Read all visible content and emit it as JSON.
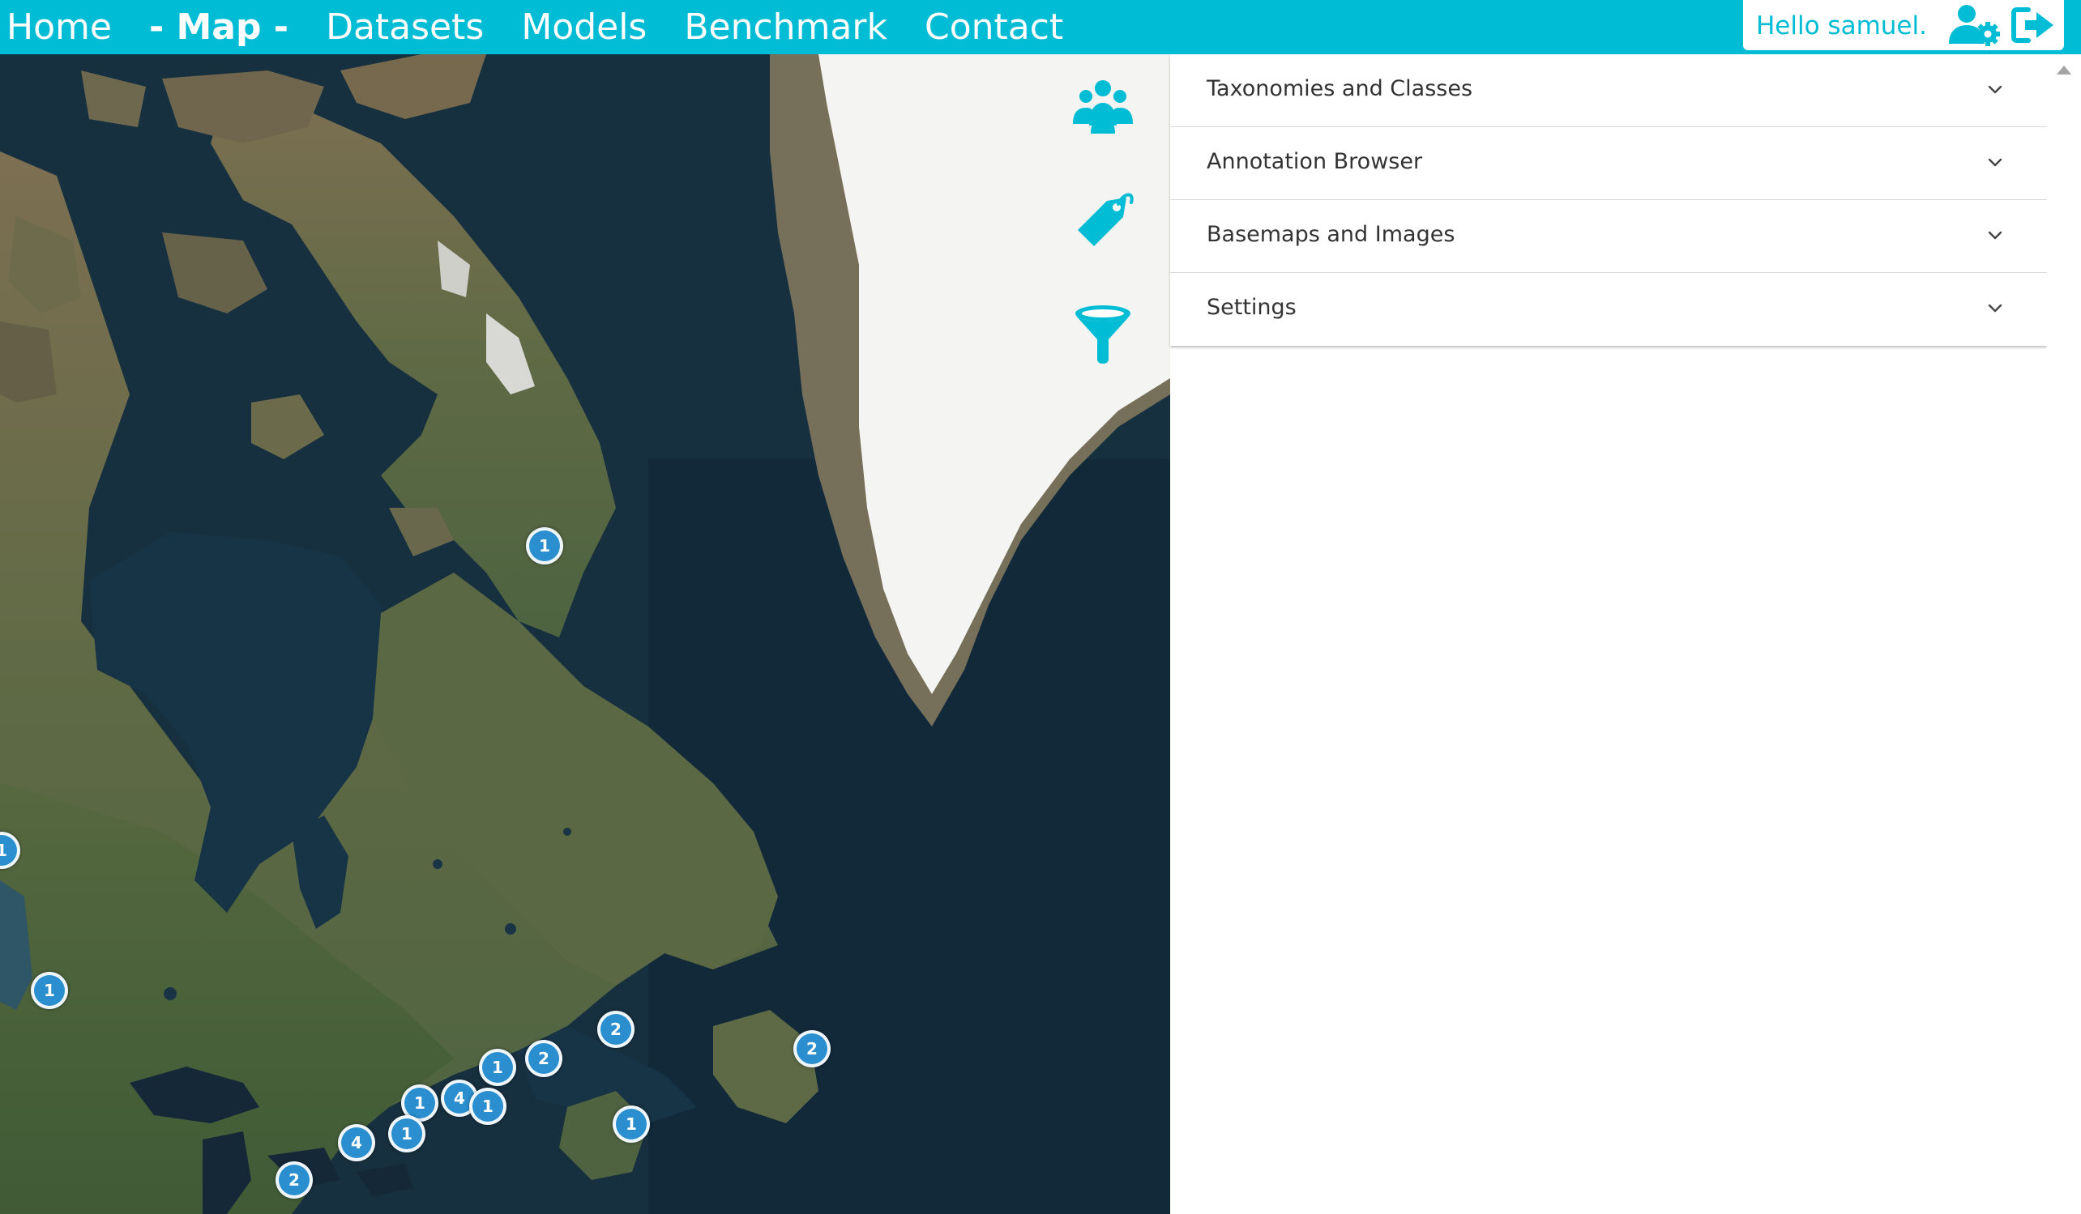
{
  "nav": {
    "links": [
      "Home",
      "- Map -",
      "Datasets",
      "Models",
      "Benchmark",
      "Contact"
    ],
    "active_index": 1,
    "greeting": "Hello samuel."
  },
  "colors": {
    "accent": "#00bcd4",
    "cluster": "#2a8ecf"
  },
  "map_tools": [
    "users-group-icon",
    "tag-icon",
    "filter-icon"
  ],
  "clusters": [
    "1",
    "1",
    "1",
    "2",
    "2",
    "2",
    "1",
    "4",
    "1",
    "1",
    "1",
    "4",
    "2",
    "1"
  ],
  "panel": {
    "sections": [
      "Taxonomies and Classes",
      "Annotation Browser",
      "Basemaps and Images",
      "Settings"
    ]
  }
}
